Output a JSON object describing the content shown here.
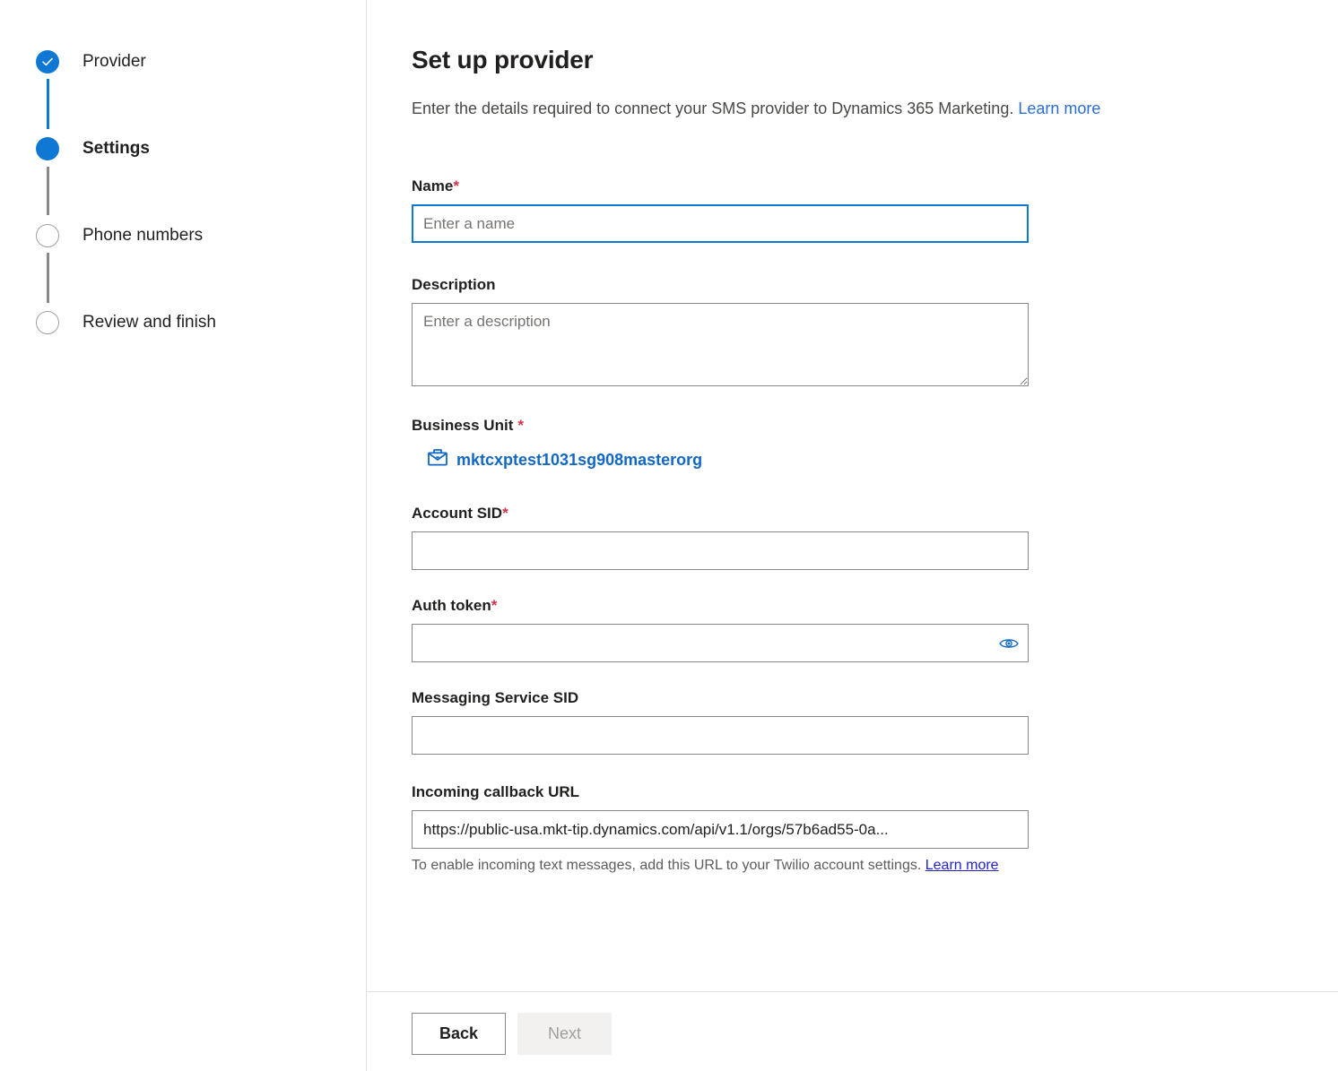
{
  "stepper": {
    "steps": [
      {
        "label": "Provider",
        "state": "done",
        "icon": "check-icon"
      },
      {
        "label": "Settings",
        "state": "current",
        "icon": "filled-circle-icon"
      },
      {
        "label": "Phone numbers",
        "state": "todo",
        "icon": "empty-circle-icon"
      },
      {
        "label": "Review and finish",
        "state": "todo",
        "icon": "empty-circle-icon"
      }
    ]
  },
  "header": {
    "title": "Set up provider",
    "subtitle": "Enter the details required to connect your SMS provider to Dynamics 365 Marketing.",
    "link_label": "Learn more"
  },
  "form": {
    "name": {
      "label": "Name",
      "required_marker": "*",
      "placeholder": "Enter a name",
      "value": ""
    },
    "description": {
      "label": "Description",
      "placeholder": "Enter a description",
      "value": ""
    },
    "business_unit": {
      "label": "Business Unit",
      "required_marker": "*",
      "icon": "briefcase-icon",
      "value": "mktcxptest1031sg908masterorg"
    },
    "account_sid": {
      "label": "Account SID",
      "required_marker": "*",
      "placeholder": "",
      "value": ""
    },
    "auth_token": {
      "label": "Auth token",
      "required_marker": "*",
      "placeholder": "",
      "value": "",
      "reveal_icon": "eye-icon"
    },
    "messaging_service_sid": {
      "label": "Messaging Service SID",
      "placeholder": "",
      "value": ""
    },
    "incoming_callback_url": {
      "label": "Incoming callback URL",
      "value": "https://public-usa.mkt-tip.dynamics.com/api/v1.1/orgs/57b6ad55-0a...",
      "hint": "To enable incoming text messages, add this URL to your Twilio account settings.",
      "hint_link_label": "Learn more"
    }
  },
  "footer": {
    "back_label": "Back",
    "next_label": "Next"
  },
  "colors": {
    "accent": "#0f78d4",
    "required": "#d1344a",
    "link": "#2a6dd4",
    "lookup_link": "#1268c3",
    "hint_link": "#2222cc",
    "step_todo_border": "#a19f9d",
    "step_connector_grey": "#8a8886",
    "disabled_button_bg": "#f3f1ef",
    "disabled_button_text": "#a19f9d"
  }
}
